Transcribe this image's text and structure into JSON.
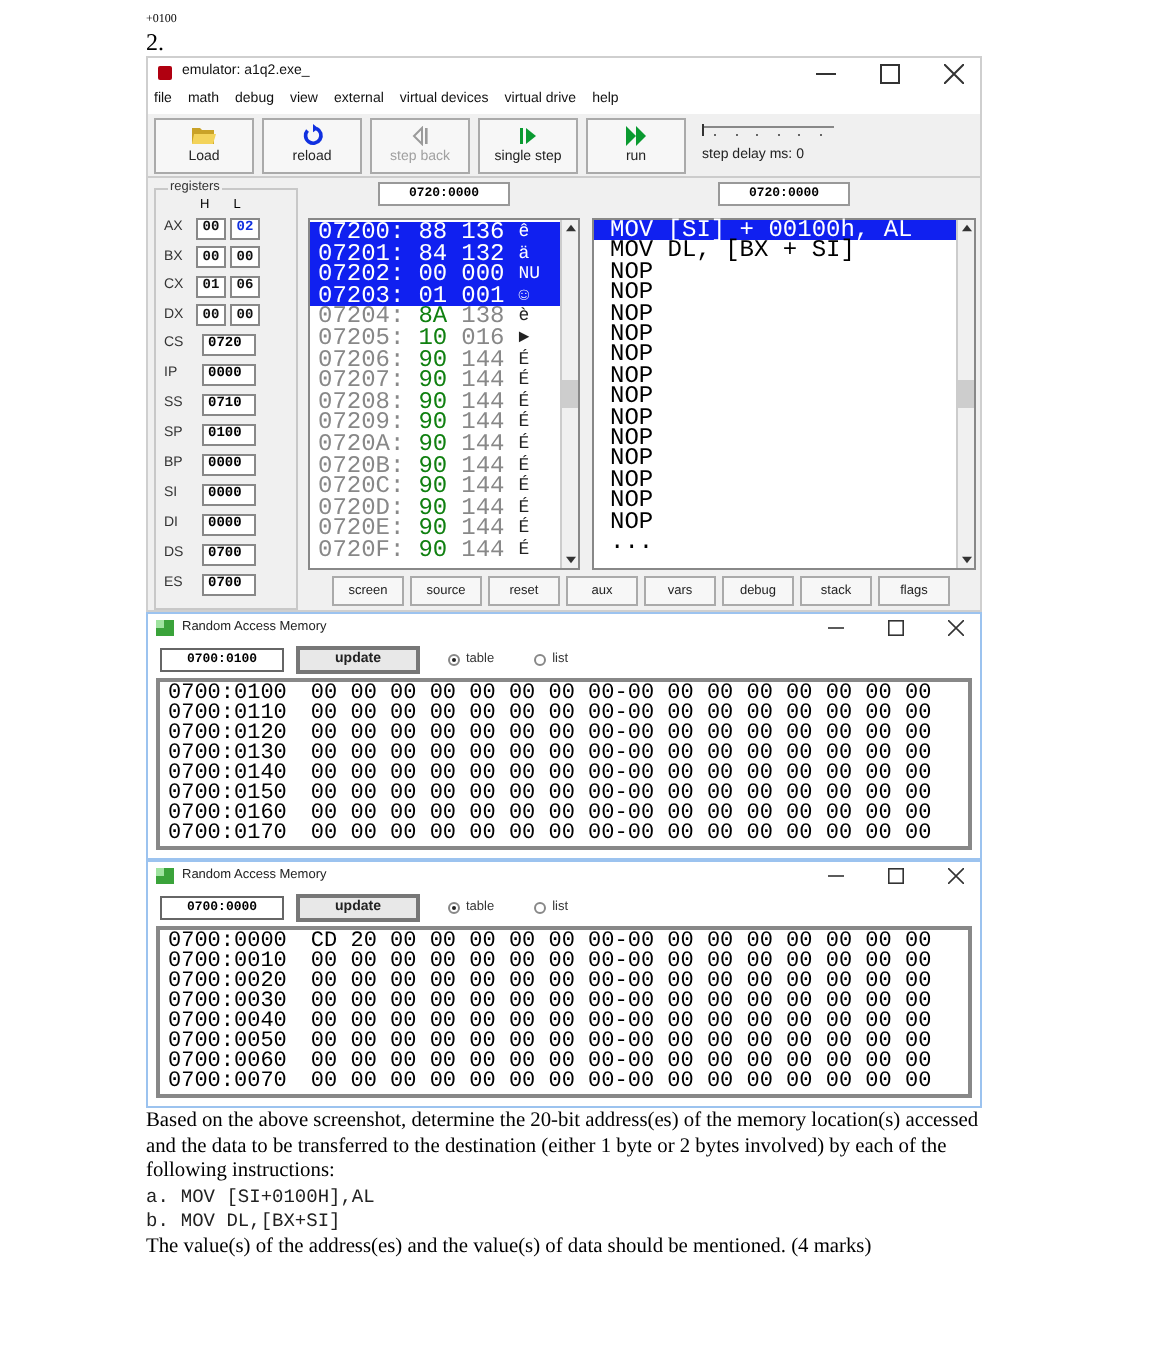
{
  "document": {
    "header": "+0100",
    "number": "2."
  },
  "emulator": {
    "title": "emulator: a1q2.exe_",
    "menu": [
      "file",
      "math",
      "debug",
      "view",
      "external",
      "virtual devices",
      "virtual drive",
      "help"
    ],
    "toolbar": [
      {
        "kind": "load",
        "label": "Load",
        "disabled": false
      },
      {
        "kind": "reload",
        "label": "reload",
        "disabled": false
      },
      {
        "kind": "step-back",
        "label": "step back",
        "disabled": true
      },
      {
        "kind": "single-step",
        "label": "single step",
        "disabled": false
      },
      {
        "kind": "run",
        "label": "run",
        "disabled": false
      }
    ],
    "step_delay": {
      "label": "step delay ms: 0",
      "level": 0
    },
    "registers": {
      "heading": "registers",
      "columns": [
        "H",
        "L"
      ],
      "pairs": [
        {
          "name": "AX",
          "high": {
            "value": "00",
            "changed": false
          },
          "low": {
            "value": "02",
            "changed": true
          }
        },
        {
          "name": "BX",
          "high": {
            "value": "00",
            "changed": false
          },
          "low": {
            "value": "00",
            "changed": false
          }
        },
        {
          "name": "CX",
          "high": {
            "value": "01",
            "changed": false
          },
          "low": {
            "value": "06",
            "changed": false
          }
        },
        {
          "name": "DX",
          "high": {
            "value": "00",
            "changed": false
          },
          "low": {
            "value": "00",
            "changed": false
          }
        }
      ],
      "singles": [
        {
          "name": "CS",
          "value": "0720"
        },
        {
          "name": "IP",
          "value": "0000"
        },
        {
          "name": "SS",
          "value": "0710"
        },
        {
          "name": "SP",
          "value": "0100"
        },
        {
          "name": "BP",
          "value": "0000"
        },
        {
          "name": "SI",
          "value": "0000"
        },
        {
          "name": "DI",
          "value": "0000"
        },
        {
          "name": "DS",
          "value": "0700"
        },
        {
          "name": "ES",
          "value": "0700"
        }
      ]
    },
    "memory_address": "0720:0000",
    "memory_list": [
      {
        "address": "07200:",
        "hex": "88",
        "dec": "136",
        "char": "ê",
        "selected": true
      },
      {
        "address": "07201:",
        "hex": "84",
        "dec": "132",
        "char": "ä",
        "selected": true
      },
      {
        "address": "07202:",
        "hex": "00",
        "dec": "000",
        "char": "NU",
        "selected": true
      },
      {
        "address": "07203:",
        "hex": "01",
        "dec": "001",
        "char": "☺",
        "selected": true
      },
      {
        "address": "07204:",
        "hex": "8A",
        "dec": "138",
        "char": "è",
        "selected": false
      },
      {
        "address": "07205:",
        "hex": "10",
        "dec": "016",
        "char": "►",
        "selected": false
      },
      {
        "address": "07206:",
        "hex": "90",
        "dec": "144",
        "char": "É",
        "selected": false
      },
      {
        "address": "07207:",
        "hex": "90",
        "dec": "144",
        "char": "É",
        "selected": false
      },
      {
        "address": "07208:",
        "hex": "90",
        "dec": "144",
        "char": "É",
        "selected": false
      },
      {
        "address": "07209:",
        "hex": "90",
        "dec": "144",
        "char": "É",
        "selected": false
      },
      {
        "address": "0720A:",
        "hex": "90",
        "dec": "144",
        "char": "É",
        "selected": false
      },
      {
        "address": "0720B:",
        "hex": "90",
        "dec": "144",
        "char": "É",
        "selected": false
      },
      {
        "address": "0720C:",
        "hex": "90",
        "dec": "144",
        "char": "É",
        "selected": false
      },
      {
        "address": "0720D:",
        "hex": "90",
        "dec": "144",
        "char": "É",
        "selected": false
      },
      {
        "address": "0720E:",
        "hex": "90",
        "dec": "144",
        "char": "É",
        "selected": false
      },
      {
        "address": "0720F:",
        "hex": "90",
        "dec": "144",
        "char": "É",
        "selected": false
      }
    ],
    "disassembly_address": "0720:0000",
    "disassembly": [
      {
        "text": "MOV [SI] + 00100h, AL",
        "selected": true
      },
      {
        "text": "MOV DL, [BX + SI]",
        "selected": false
      },
      {
        "text": "NOP",
        "selected": false
      },
      {
        "text": "NOP",
        "selected": false
      },
      {
        "text": "NOP",
        "selected": false
      },
      {
        "text": "NOP",
        "selected": false
      },
      {
        "text": "NOP",
        "selected": false
      },
      {
        "text": "NOP",
        "selected": false
      },
      {
        "text": "NOP",
        "selected": false
      },
      {
        "text": "NOP",
        "selected": false
      },
      {
        "text": "NOP",
        "selected": false
      },
      {
        "text": "NOP",
        "selected": false
      },
      {
        "text": "NOP",
        "selected": false
      },
      {
        "text": "NOP",
        "selected": false
      },
      {
        "text": "NOP",
        "selected": false
      },
      {
        "text": "...",
        "selected": false
      }
    ],
    "buttons": [
      "screen",
      "source",
      "reset",
      "aux",
      "vars",
      "debug",
      "stack",
      "flags"
    ]
  },
  "ram_windows": [
    {
      "title": "Random Access Memory",
      "address": "0700:0100",
      "update": "update",
      "views": [
        {
          "label": "table",
          "selected": true
        },
        {
          "label": "list",
          "selected": false
        }
      ],
      "rows": [
        {
          "address": "0700:0100",
          "data": "00 00 00 00 00 00 00 00-00 00 00 00 00 00 00 00"
        },
        {
          "address": "0700:0110",
          "data": "00 00 00 00 00 00 00 00-00 00 00 00 00 00 00 00"
        },
        {
          "address": "0700:0120",
          "data": "00 00 00 00 00 00 00 00-00 00 00 00 00 00 00 00"
        },
        {
          "address": "0700:0130",
          "data": "00 00 00 00 00 00 00 00-00 00 00 00 00 00 00 00"
        },
        {
          "address": "0700:0140",
          "data": "00 00 00 00 00 00 00 00-00 00 00 00 00 00 00 00"
        },
        {
          "address": "0700:0150",
          "data": "00 00 00 00 00 00 00 00-00 00 00 00 00 00 00 00"
        },
        {
          "address": "0700:0160",
          "data": "00 00 00 00 00 00 00 00-00 00 00 00 00 00 00 00"
        },
        {
          "address": "0700:0170",
          "data": "00 00 00 00 00 00 00 00-00 00 00 00 00 00 00 00"
        }
      ]
    },
    {
      "title": "Random Access Memory",
      "address": "0700:0000",
      "update": "update",
      "views": [
        {
          "label": "table",
          "selected": true
        },
        {
          "label": "list",
          "selected": false
        }
      ],
      "rows": [
        {
          "address": "0700:0000",
          "data": "CD 20 00 00 00 00 00 00-00 00 00 00 00 00 00 00"
        },
        {
          "address": "0700:0010",
          "data": "00 00 00 00 00 00 00 00-00 00 00 00 00 00 00 00"
        },
        {
          "address": "0700:0020",
          "data": "00 00 00 00 00 00 00 00-00 00 00 00 00 00 00 00"
        },
        {
          "address": "0700:0030",
          "data": "00 00 00 00 00 00 00 00-00 00 00 00 00 00 00 00"
        },
        {
          "address": "0700:0040",
          "data": "00 00 00 00 00 00 00 00-00 00 00 00 00 00 00 00"
        },
        {
          "address": "0700:0050",
          "data": "00 00 00 00 00 00 00 00-00 00 00 00 00 00 00 00"
        },
        {
          "address": "0700:0060",
          "data": "00 00 00 00 00 00 00 00-00 00 00 00 00 00 00 00"
        },
        {
          "address": "0700:0070",
          "data": "00 00 00 00 00 00 00 00-00 00 00 00 00 00 00 00"
        }
      ]
    }
  ],
  "question": {
    "paragraph": "Based on the above screenshot, determine the 20-bit address(es) of the memory location(s) accessed and the data to be transferred to the destination (either 1 byte or 2 bytes involved) by each of the following instructions:",
    "instructions": [
      {
        "label": "a.",
        "code": "MOV [SI+0100H],AL"
      },
      {
        "label": "b.",
        "code": "MOV DL,[BX+SI]"
      }
    ],
    "closing": "The value(s) of the address(es) and the value(s) of data should be mentioned. (4 marks)"
  }
}
